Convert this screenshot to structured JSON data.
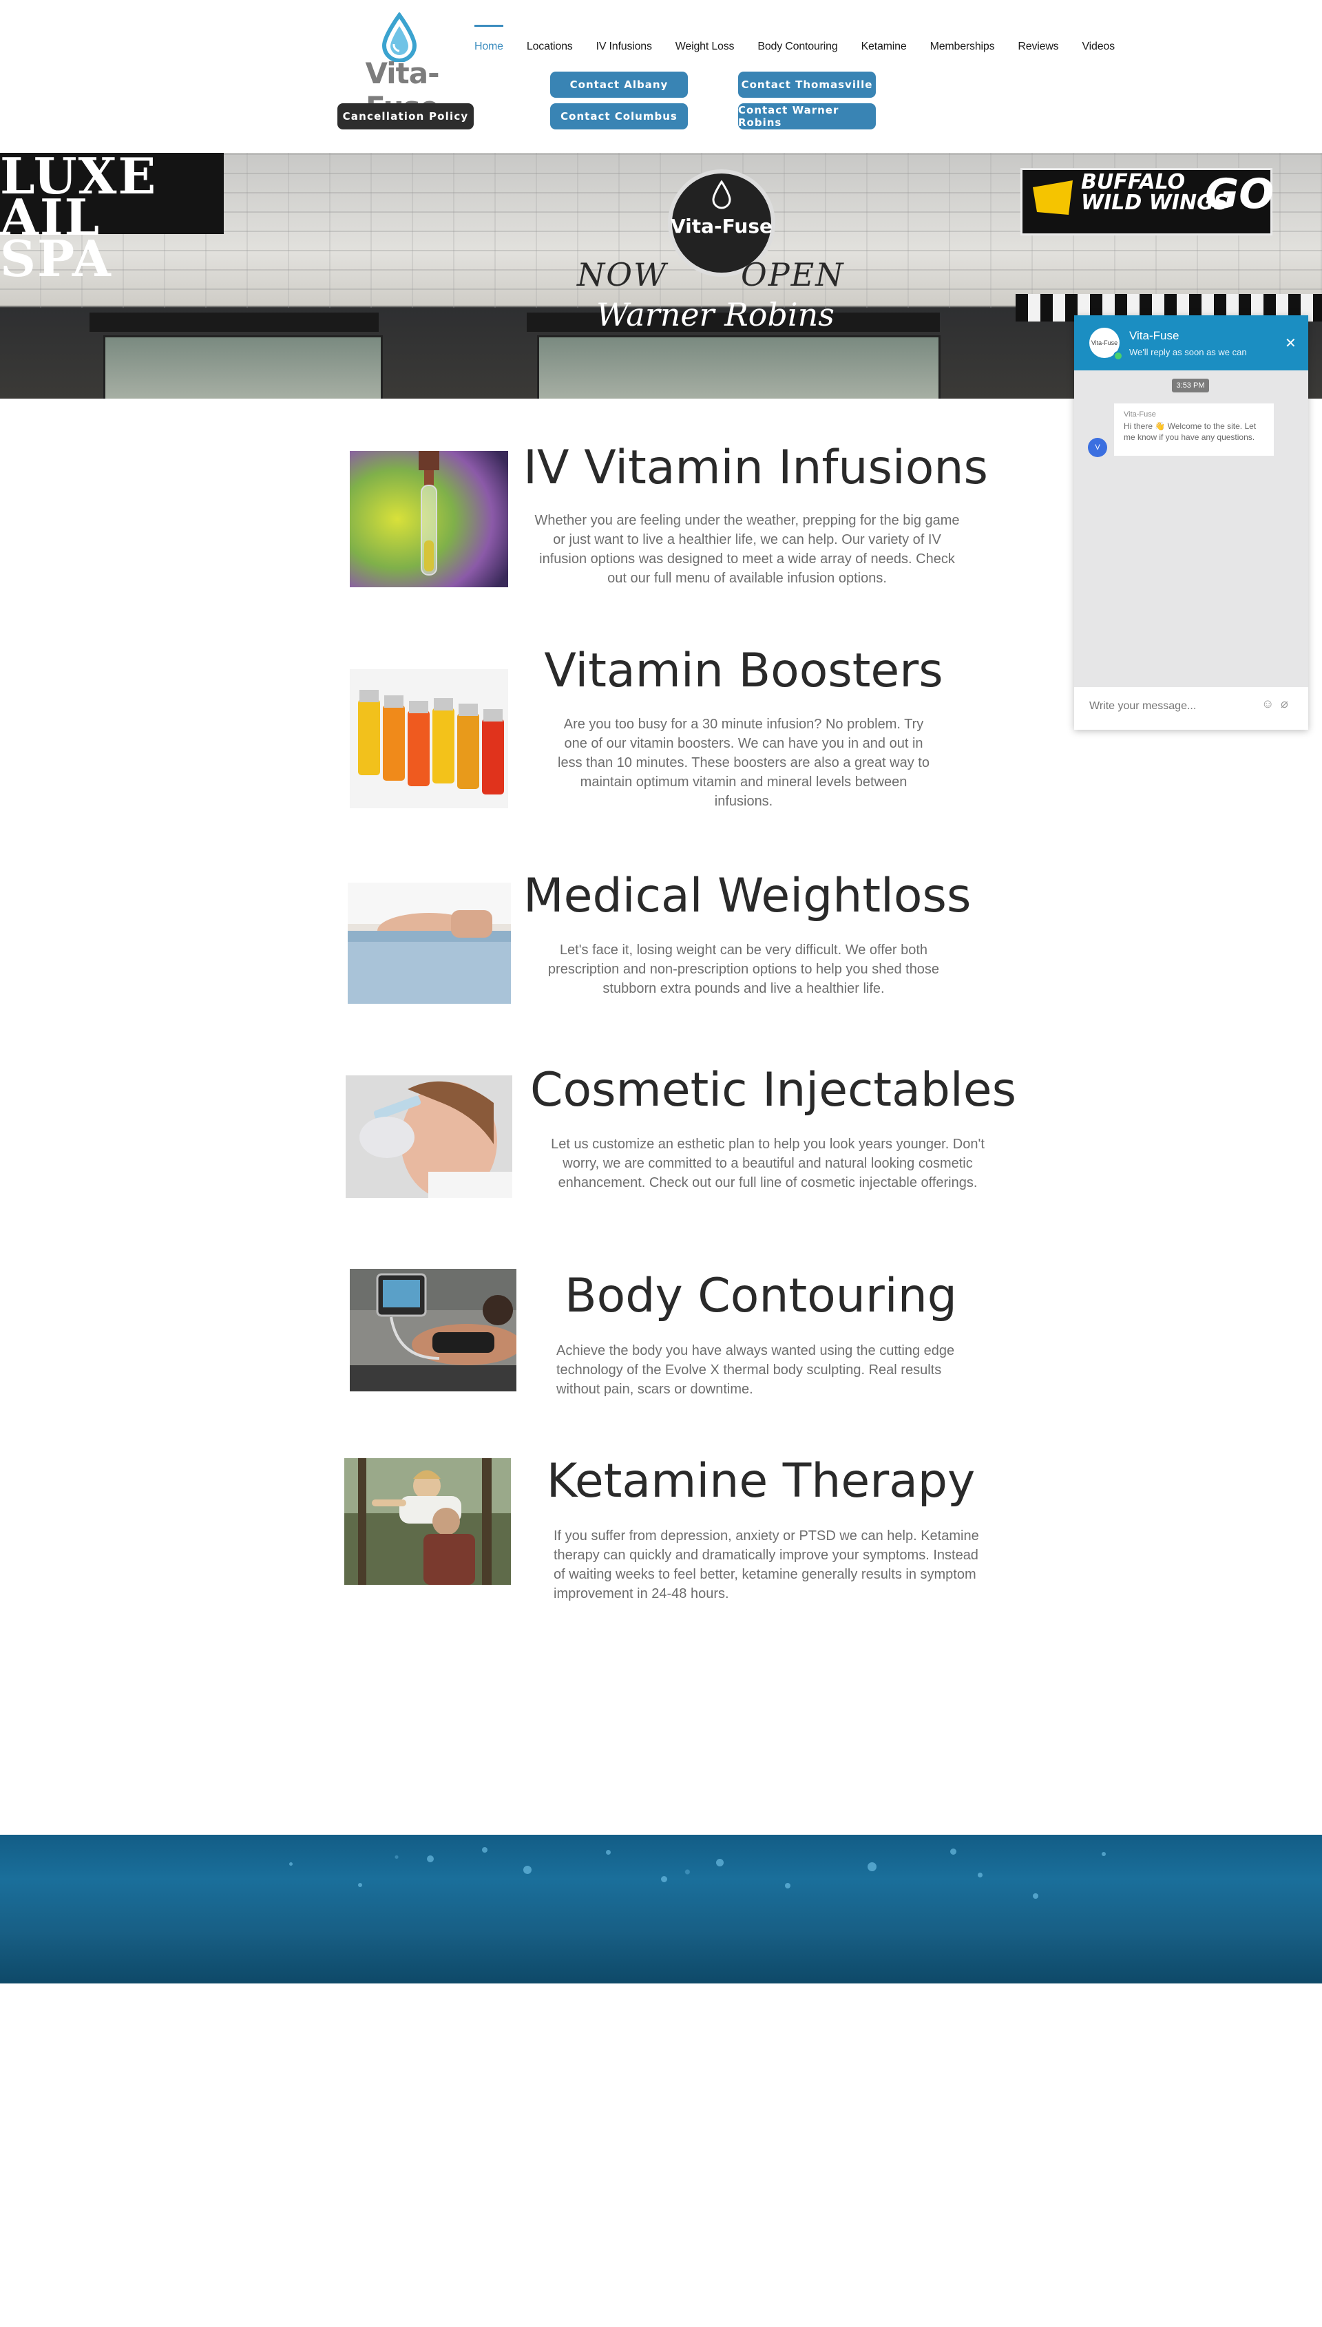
{
  "brand": {
    "name": "Vita-Fuse",
    "accent": "#3c8dbf",
    "button_blue": "#3984b4",
    "button_dark": "#2d2d2d"
  },
  "header": {
    "cancellation_label": "Cancellation Policy",
    "contact_buttons": [
      "Contact Albany",
      "Contact Thomasville",
      "Contact Columbus",
      "Contact Warner Robins"
    ],
    "nav": [
      "Home",
      "Locations",
      "IV Infusions",
      "Weight Loss",
      "Body Contouring",
      "Ketamine",
      "Memberships",
      "Reviews",
      "Videos"
    ],
    "active_nav": "Home"
  },
  "hero": {
    "logo_text": "Vita-Fuse",
    "now": "NOW",
    "open": "OPEN",
    "city": "Warner Robins",
    "left_sign": "LUXE\nAIL SPA",
    "right_sign_line1": "BUFFALO",
    "right_sign_line2": "WILD WINGS",
    "right_sign_go": "GO"
  },
  "services": [
    {
      "title": "IV Vitamin Infusions",
      "desc": "Whether you are feeling under the weather, prepping for the big game or just want to live a healthier life, we can help.  Our variety of IV infusion options was designed to meet a wide array of needs.  Check out our full menu of available infusion options.",
      "image_icon": "iv-drip-image"
    },
    {
      "title": "Vitamin Boosters",
      "desc": "Are you too busy for a 30 minute infusion? No problem. Try one of our vitamin boosters.  We can have you in and out in less than 10 minutes.  These boosters are also a great way to maintain optimum vitamin and mineral levels between infusions.",
      "image_icon": "vials-image"
    },
    {
      "title": "Medical Weightloss",
      "desc": "Let's face it, losing weight can be very difficult.  We offer both prescription and non-prescription options to help you shed those stubborn extra pounds and live a healthier life.",
      "image_icon": "waist-image"
    },
    {
      "title": "Cosmetic Injectables",
      "desc": "Let us customize an esthetic plan to help you look years younger. Don't worry, we are committed to a beautiful and natural looking cosmetic enhancement. Check out our full line of cosmetic injectable offerings.",
      "image_icon": "injection-image"
    },
    {
      "title": "Body Contouring",
      "desc": "Achieve the body you have always wanted using the cutting edge technology of the Evolve X thermal body sculpting.  Real results without pain, scars or downtime.",
      "image_icon": "contouring-image"
    },
    {
      "title": "Ketamine Therapy",
      "desc": "If you suffer from depression, anxiety or PTSD we can help.  Ketamine therapy can quickly and dramatically improve your symptoms.  Instead of waiting weeks to feel better, ketamine generally results in symptom improvement in 24-48 hours.",
      "image_icon": "happy-couple-image"
    }
  ],
  "chat": {
    "name": "Vita-Fuse",
    "subtitle": "We'll reply as soon as we can",
    "avatar_text": "Vita-Fuse",
    "time": "3:53 PM",
    "bot_initial": "V",
    "bubble_name": "Vita-Fuse",
    "bubble_text": "Hi there 👋 Welcome to the site. Let me know if you have any questions.",
    "input_placeholder": "Write your message...",
    "header_color": "#1b8ec2"
  }
}
